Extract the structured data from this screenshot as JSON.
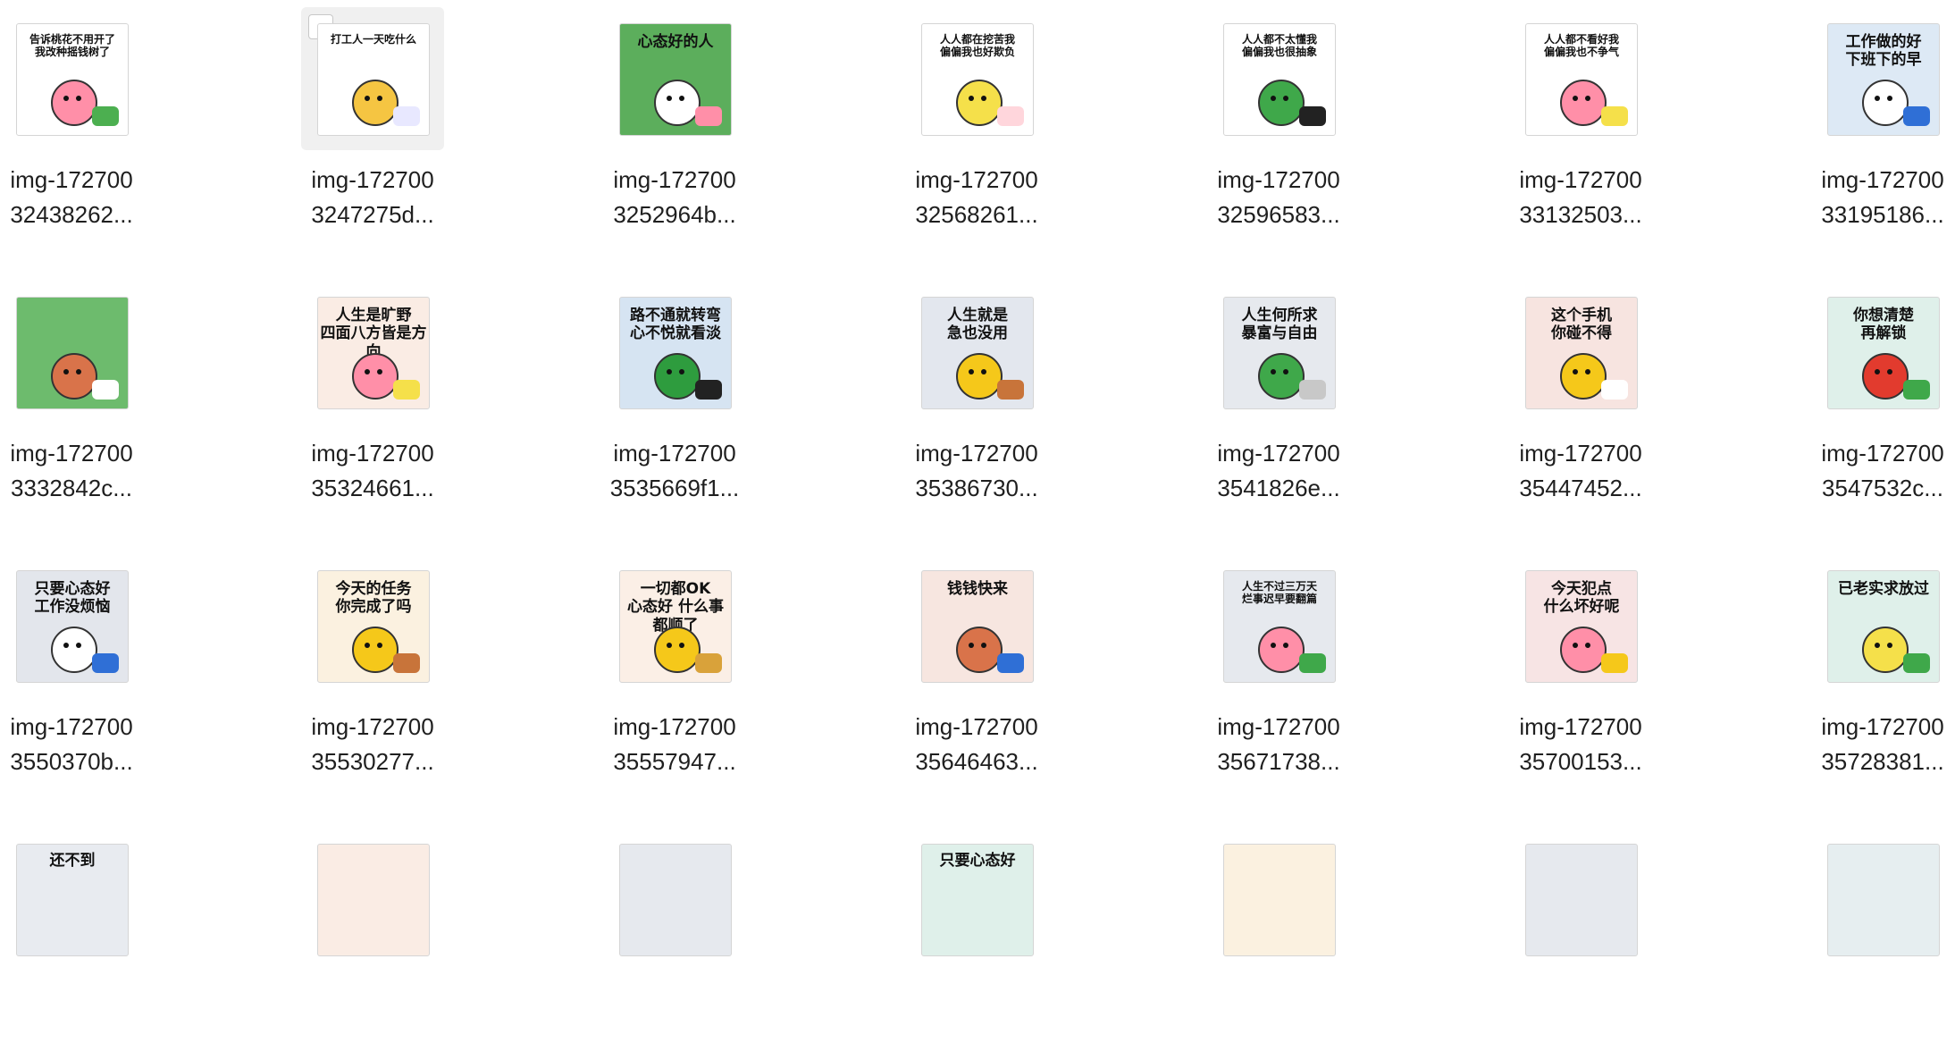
{
  "files": [
    {
      "line1": "img-172700",
      "line2": "32438262...",
      "caption": "告诉桃花不用开了\n我改种摇钱树了",
      "bg": "#ffffff",
      "accent": "#ff8fa8",
      "accent2": "#4caf50",
      "selected": false
    },
    {
      "line1": "img-172700",
      "line2": "3247275d...",
      "caption": "打工人一天吃什么",
      "bg": "#ffffff",
      "accent": "#f5c542",
      "accent2": "#e8e8ff",
      "selected": true
    },
    {
      "line1": "img-172700",
      "line2": "3252964b...",
      "caption": "心态好的人",
      "bg": "#5cae5c",
      "accent": "#ffffff",
      "accent2": "#ff8fa8",
      "selected": false
    },
    {
      "line1": "img-172700",
      "line2": "32568261...",
      "caption": "人人都在挖苦我\n偏偏我也好欺负",
      "bg": "#ffffff",
      "accent": "#f5e04a",
      "accent2": "#ffd6dc",
      "selected": false
    },
    {
      "line1": "img-172700",
      "line2": "32596583...",
      "caption": "人人都不太懂我\n偏偏我也很抽象",
      "bg": "#ffffff",
      "accent": "#3fa84a",
      "accent2": "#222222",
      "selected": false
    },
    {
      "line1": "img-172700",
      "line2": "33132503...",
      "caption": "人人都不看好我\n偏偏我也不争气",
      "bg": "#ffffff",
      "accent": "#ff8fa8",
      "accent2": "#f5e04a",
      "selected": false
    },
    {
      "line1": "img-172700",
      "line2": "33195186...",
      "caption": "工作做的好\n下班下的早",
      "bg": "#dde9f5",
      "accent": "#ffffff",
      "accent2": "#2f6fd6",
      "selected": false
    },
    {
      "line1": "img-172700",
      "line2": "3332842c...",
      "caption": "",
      "bg": "#6dbb6d",
      "accent": "#d9734a",
      "accent2": "#ffffff",
      "selected": false
    },
    {
      "line1": "img-172700",
      "line2": "35324661...",
      "caption": "人生是旷野\n四面八方皆是方向",
      "bg": "#faece4",
      "accent": "#ff8fa8",
      "accent2": "#f5e04a",
      "selected": false
    },
    {
      "line1": "img-172700",
      "line2": "3535669f1...",
      "caption": "路不通就转弯\n心不悦就看淡",
      "bg": "#d6e4f2",
      "accent": "#2e9c3e",
      "accent2": "#222222",
      "selected": false
    },
    {
      "line1": "img-172700",
      "line2": "35386730...",
      "caption": "人生就是\n急也没用",
      "bg": "#e3e7ee",
      "accent": "#f5c81a",
      "accent2": "#c8743a",
      "selected": false
    },
    {
      "line1": "img-172700",
      "line2": "3541826e...",
      "caption": "人生何所求\n暴富与自由",
      "bg": "#e6e9ee",
      "accent": "#3fa84a",
      "accent2": "#c8c8c8",
      "selected": false
    },
    {
      "line1": "img-172700",
      "line2": "35447452...",
      "caption": "这个手机\n你碰不得",
      "bg": "#f7e4e0",
      "accent": "#f5c81a",
      "accent2": "#ffffff",
      "selected": false
    },
    {
      "line1": "img-172700",
      "line2": "3547532c...",
      "caption": "你想清楚\n再解锁",
      "bg": "#dff0ea",
      "accent": "#e23b2e",
      "accent2": "#3fa84a",
      "selected": false
    },
    {
      "line1": "img-172700",
      "line2": "3550370b...",
      "caption": "只要心态好\n工作没烦恼",
      "bg": "#e3e6ec",
      "accent": "#ffffff",
      "accent2": "#2f6fd6",
      "selected": false
    },
    {
      "line1": "img-172700",
      "line2": "35530277...",
      "caption": "今天的任务\n你完成了吗",
      "bg": "#fbf1e0",
      "accent": "#f5c81a",
      "accent2": "#c8743a",
      "selected": false
    },
    {
      "line1": "img-172700",
      "line2": "35557947...",
      "caption": "一切都OK\n心态好 什么事都顺了",
      "bg": "#fbefe6",
      "accent": "#f5c81a",
      "accent2": "#d9a23a",
      "selected": false
    },
    {
      "line1": "img-172700",
      "line2": "35646463...",
      "caption": "钱钱快来",
      "bg": "#f7e6e0",
      "accent": "#d9734a",
      "accent2": "#2f6fd6",
      "selected": false
    },
    {
      "line1": "img-172700",
      "line2": "35671738...",
      "caption": "人生不过三万天\n烂事迟早要翻篇",
      "bg": "#e6e9ee",
      "accent": "#ff8fa8",
      "accent2": "#3fa84a",
      "selected": false
    },
    {
      "line1": "img-172700",
      "line2": "35700153...",
      "caption": "今天犯点\n什么坏好呢",
      "bg": "#f7e4e4",
      "accent": "#ff8fa8",
      "accent2": "#f5c81a",
      "selected": false
    },
    {
      "line1": "img-172700",
      "line2": "35728381...",
      "caption": "已老实求放过",
      "bg": "#dff0ea",
      "accent": "#f5e04a",
      "accent2": "#3fa84a",
      "selected": false
    }
  ],
  "partial_row": [
    {
      "bg": "#e8ebf0",
      "caption": "还不到"
    },
    {
      "bg": "#faece4",
      "caption": ""
    },
    {
      "bg": "#e6e9ee",
      "caption": ""
    },
    {
      "bg": "#dff0ea",
      "caption": "只要心态好"
    },
    {
      "bg": "#fbf1e0",
      "caption": ""
    },
    {
      "bg": "#e6e9ee",
      "caption": ""
    },
    {
      "bg": "#e6eef0",
      "caption": ""
    }
  ]
}
